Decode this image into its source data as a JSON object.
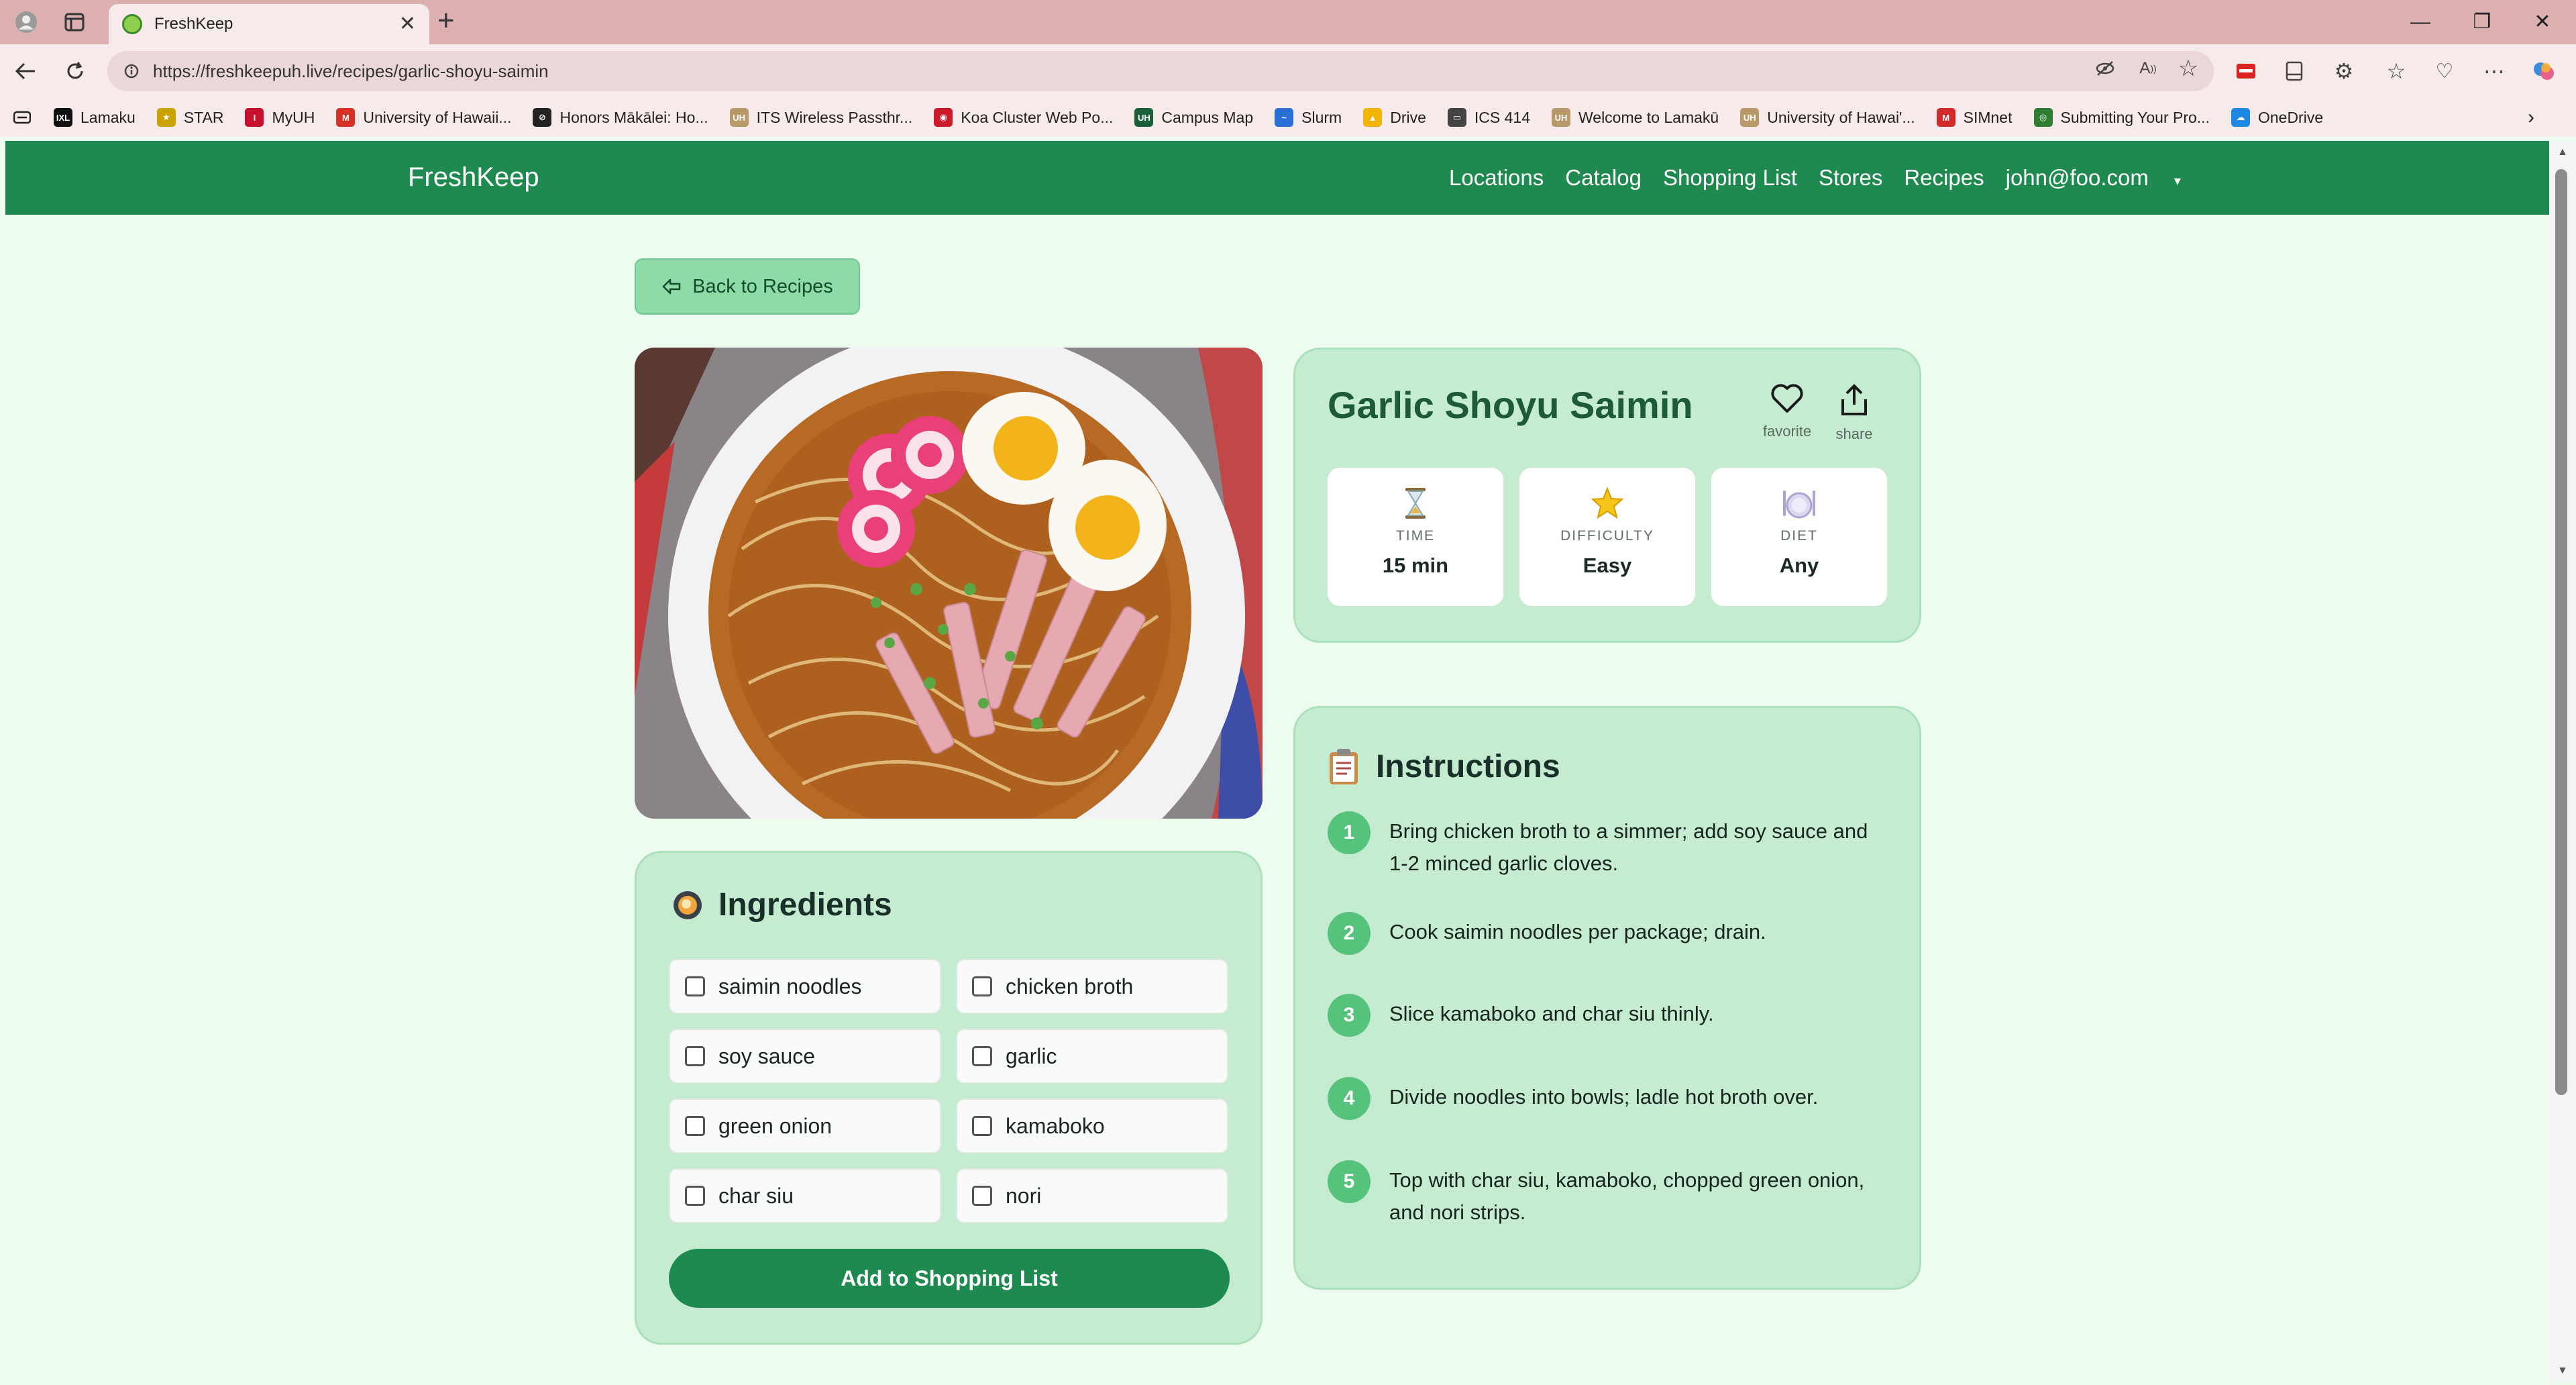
{
  "browser": {
    "tab_title": "FreshKeep",
    "url": "https://freshkeepuh.live/recipes/garlic-shoyu-saimin",
    "bookmarks": [
      {
        "label": "Lamaku",
        "color": "#111111",
        "abbr": "IXL"
      },
      {
        "label": "STAR",
        "color": "#c9a400",
        "abbr": "★"
      },
      {
        "label": "MyUH",
        "color": "#c8102e",
        "abbr": "I"
      },
      {
        "label": "University of Hawaii...",
        "color": "#d93025",
        "abbr": "M"
      },
      {
        "label": "Honors Mākālei: Ho...",
        "color": "#222222",
        "abbr": "⊘"
      },
      {
        "label": "ITS Wireless Passthr...",
        "color": "#b89a6a",
        "abbr": "UH"
      },
      {
        "label": "Koa Cluster Web Po...",
        "color": "#cc1a2b",
        "abbr": "◉"
      },
      {
        "label": "Campus Map",
        "color": "#1b5e3a",
        "abbr": "UH"
      },
      {
        "label": "Slurm",
        "color": "#2a6fd6",
        "abbr": "~"
      },
      {
        "label": "Drive",
        "color": "#f2b400",
        "abbr": "▲"
      },
      {
        "label": "ICS 414",
        "color": "#444444",
        "abbr": "▭"
      },
      {
        "label": "Welcome to Lamakū",
        "color": "#b89a6a",
        "abbr": "UH"
      },
      {
        "label": "University of Hawai'...",
        "color": "#b89a6a",
        "abbr": "UH"
      },
      {
        "label": "SIMnet",
        "color": "#d12a2a",
        "abbr": "M"
      },
      {
        "label": "Submitting Your Pro...",
        "color": "#2e7d32",
        "abbr": "◎"
      },
      {
        "label": "OneDrive",
        "color": "#1e88e5",
        "abbr": "☁"
      }
    ]
  },
  "nav": {
    "brand": "FreshKeep",
    "links": [
      "Locations",
      "Catalog",
      "Shopping List",
      "Stores",
      "Recipes"
    ],
    "user": "john@foo.com"
  },
  "back_label": "Back to Recipes",
  "recipe": {
    "title": "Garlic Shoyu Saimin",
    "favorite_label": "favorite",
    "share_label": "share",
    "stats": [
      {
        "label": "TIME",
        "value": "15 min",
        "icon": "hourglass-icon"
      },
      {
        "label": "DIFFICULTY",
        "value": "Easy",
        "icon": "star-icon"
      },
      {
        "label": "DIET",
        "value": "Any",
        "icon": "plate-icon"
      }
    ]
  },
  "ingredients": {
    "title": "Ingredients",
    "items": [
      "saimin noodles",
      "chicken broth",
      "soy sauce",
      "garlic",
      "green onion",
      "kamaboko",
      "char siu",
      "nori"
    ],
    "button": "Add to Shopping List"
  },
  "instructions": {
    "title": "Instructions",
    "steps": [
      {
        "n": "1",
        "text": "Bring chicken broth to a simmer; add soy sauce and 1-2 minced garlic cloves."
      },
      {
        "n": "2",
        "text": "Cook saimin noodles per package; drain."
      },
      {
        "n": "3",
        "text": "Slice kamaboko and char siu thinly."
      },
      {
        "n": "4",
        "text": "Divide noodles into bowls; ladle hot broth over."
      },
      {
        "n": "5",
        "text": "Top with char siu, kamaboko, chopped green onion, and nori strips."
      }
    ]
  },
  "colors": {
    "brand_green": "#1e8a4f",
    "card_bg": "#c5ecd0",
    "page_bg": "#eefcf0"
  }
}
